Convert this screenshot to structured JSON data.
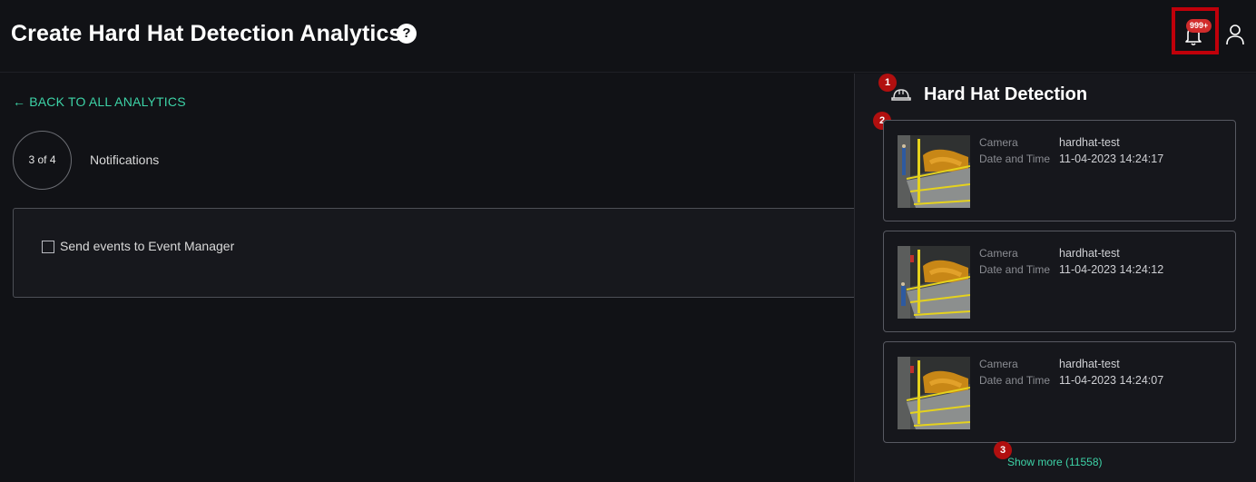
{
  "header": {
    "title": "Create Hard Hat Detection Analytics",
    "help_icon": "help-icon",
    "notifications_badge": "999+",
    "bell_icon": "bell-icon",
    "user_icon": "user-icon",
    "highlight_color": "#c0000a"
  },
  "main": {
    "back_link": "BACK TO ALL ANALYTICS",
    "step": "3 of 4",
    "step_label": "Notifications",
    "checkbox_label": "Send events to Event Manager",
    "checkbox_checked": false,
    "accent_color": "#3dd3a7"
  },
  "drawer": {
    "title": "Hard Hat Detection",
    "title_icon": "hard-hat-icon",
    "markers": [
      "1",
      "2",
      "3"
    ],
    "events": [
      {
        "camera_label": "Camera",
        "camera": "hardhat-test",
        "datetime_label": "Date and Time",
        "datetime": "11-04-2023 14:24:17"
      },
      {
        "camera_label": "Camera",
        "camera": "hardhat-test",
        "datetime_label": "Date and Time",
        "datetime": "11-04-2023 14:24:12"
      },
      {
        "camera_label": "Camera",
        "camera": "hardhat-test",
        "datetime_label": "Date and Time",
        "datetime": "11-04-2023 14:24:07"
      }
    ],
    "show_more": "Show more (11558)"
  }
}
